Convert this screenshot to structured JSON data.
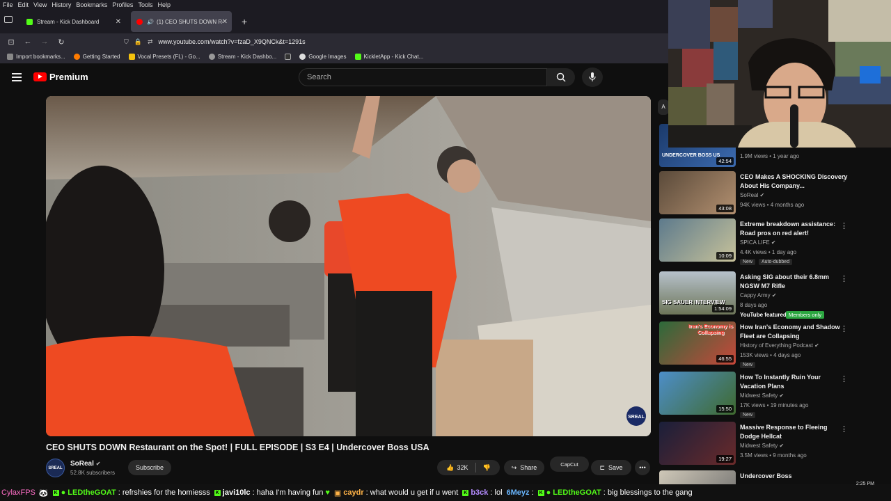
{
  "menubar": {
    "items": [
      "File",
      "Edit",
      "View",
      "History",
      "Bookmarks",
      "Profiles",
      "Tools",
      "Help"
    ]
  },
  "tabs": [
    {
      "label": "Stream - Kick Dashboard"
    },
    {
      "label": "(1) CEO SHUTS DOWN Rest"
    }
  ],
  "url": "www.youtube.com/watch?v=fzaD_X9QNCk&t=1291s",
  "bookmarks": [
    "Import bookmarks...",
    "Getting Started",
    "Vocal Presets (FL) - Go...",
    "Stream - Kick Dashbo...",
    "Google Images",
    "KickletApp - Kick Chat..."
  ],
  "youtube": {
    "logo_text": "Premium",
    "search_placeholder": "Search",
    "video_title": "CEO SHUTS DOWN Restaurant on the Spot! | FULL EPISODE | S3 E4 | Undercover Boss USA",
    "channel": "SoReal",
    "subscribers": "52.8K subscribers",
    "subscribe_label": "Subscribe",
    "likes": "32K",
    "share_label": "Share",
    "capcut_label": "CapCut",
    "save_label": "Save",
    "watermark": "SREAL"
  },
  "recommendations": [
    {
      "title": "",
      "channel": "",
      "meta": "1.9M views • 1 year ago",
      "duration": "42:54",
      "thumb_text": "UNDERCOVER BOSS US",
      "badges": []
    },
    {
      "title": "CEO Makes A SHOCKING Discovery About His Company...",
      "channel": "SoReal",
      "meta": "94K views • 4 months ago",
      "duration": "43:08",
      "thumb_text": "",
      "badges": []
    },
    {
      "title": "Extreme breakdown assistance: Road pros on red alert!",
      "channel": "SPICA LIFE",
      "meta": "4.4K views • 1 day ago",
      "duration": "10:09",
      "thumb_text": "",
      "badges": [
        "New",
        "Auto-dubbed"
      ]
    },
    {
      "title": "Asking SIG about their 6.8mm NGSW M7 Rifle",
      "channel": "Cappy Army",
      "meta": "8 days ago",
      "duration": "1:54:09",
      "thumb_text": "SIG SAUER INTERVIEW",
      "badges": [
        "YouTube featured",
        "Members only"
      ]
    },
    {
      "title": "How Iran's Economy and Shadow Fleet are Collapsing",
      "channel": "History of Everything Podcast",
      "meta": "153K views • 4 days ago",
      "duration": "46:55",
      "thumb_text": "Iran's Economy is Collapsing",
      "badges": [
        "New"
      ]
    },
    {
      "title": "How To Instantly Ruin Your Vacation Plans",
      "channel": "Midwest Safety",
      "meta": "17K views • 19 minutes ago",
      "duration": "15:50",
      "thumb_text": "",
      "badges": [
        "New"
      ]
    },
    {
      "title": "Massive Response to Fleeing Dodge Hellcat",
      "channel": "Midwest Safety",
      "meta": "3.5M views • 9 months ago",
      "duration": "19:27",
      "thumb_text": "",
      "badges": []
    },
    {
      "title": "Undercover Boss",
      "channel": "",
      "meta": "",
      "duration": "",
      "thumb_text": "",
      "badges": []
    }
  ],
  "chat": [
    {
      "user": "CylaxFPS",
      "text": "",
      "color": "#ff6ec7"
    },
    {
      "user": "LEDtheGOAT",
      "text": ": refrshies for the homiesss",
      "color": "#53fc18"
    },
    {
      "user": "javi10lc",
      "text": ": haha I'm having fun",
      "color": "#ffffff"
    },
    {
      "user": "caydr",
      "text": ": what would u get if u went",
      "color": "#ffb347"
    },
    {
      "user": "b3ck",
      "text": ": lol",
      "color": "#b58cff"
    },
    {
      "user": "6Meyz",
      "text": ":",
      "color": "#6ab7ff"
    },
    {
      "user": "LEDtheGOAT",
      "text": ": big blessings to the gang",
      "color": "#53fc18"
    }
  ],
  "clock": "2:25 PM",
  "colors": {
    "yt_red": "#ff0000",
    "kick_green": "#53fc18",
    "bg": "#0f0f0f"
  }
}
